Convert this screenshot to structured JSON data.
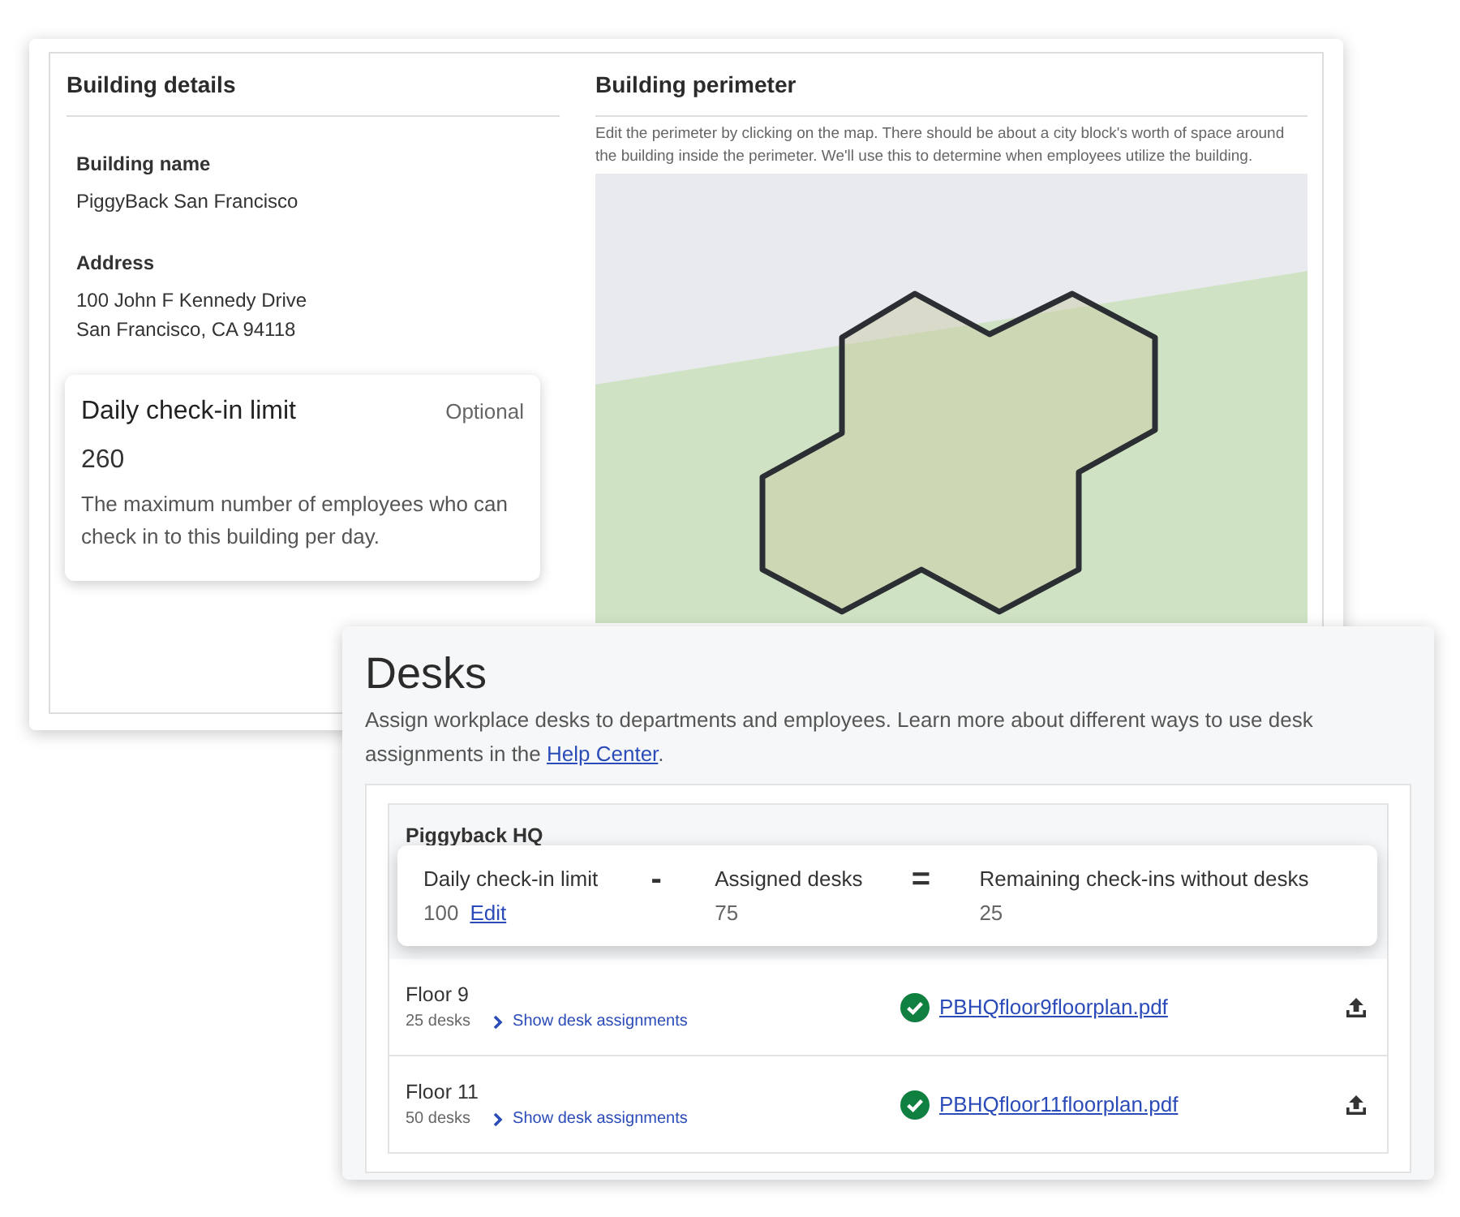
{
  "building_details": {
    "title": "Building details",
    "fields": [
      {
        "label": "Building name",
        "lines": [
          "PiggyBack San Francisco"
        ]
      },
      {
        "label": "Address",
        "lines": [
          "100 John F Kennedy Drive",
          "San Francisco, CA 94118"
        ]
      }
    ]
  },
  "check_in_limit": {
    "title": "Daily check-in limit",
    "optional_label": "Optional",
    "value": "260",
    "description": "The maximum number of employees who can check in to this building per day."
  },
  "building_perimeter": {
    "title": "Building perimeter",
    "description": "Edit the perimeter by clicking on the map. There should be about a city block's worth of space around the building inside the perimeter. We'll use this to determine when employees utilize the building."
  },
  "desks": {
    "title": "Desks",
    "description": "Assign workplace desks to departments and employees. Learn more about different ways to use desk assignments in the",
    "link": "Help Center",
    "description_end": ".",
    "location": "Piggyback HQ",
    "summary": [
      {
        "kind": "term",
        "label": "Daily check-in limit",
        "value": "100",
        "action": "Edit"
      },
      {
        "kind": "operator",
        "symbol": "-"
      },
      {
        "kind": "term",
        "label": "Assigned desks",
        "value": "75"
      },
      {
        "kind": "operator",
        "symbol": "="
      },
      {
        "kind": "term",
        "label": "Remaining check-ins without desks",
        "value": "25"
      }
    ],
    "floors": [
      {
        "name": "Floor 9",
        "desk_count": "25 desks",
        "toggle_label": "Show desk assignments",
        "expanded": false,
        "file_name": "PBHQfloor9floorplan.pdf"
      },
      {
        "name": "Floor 11",
        "desk_count": "50 desks",
        "toggle_label": "Show desk assignments",
        "expanded": false,
        "file_name": "PBHQfloor11floorplan.pdf"
      }
    ]
  }
}
